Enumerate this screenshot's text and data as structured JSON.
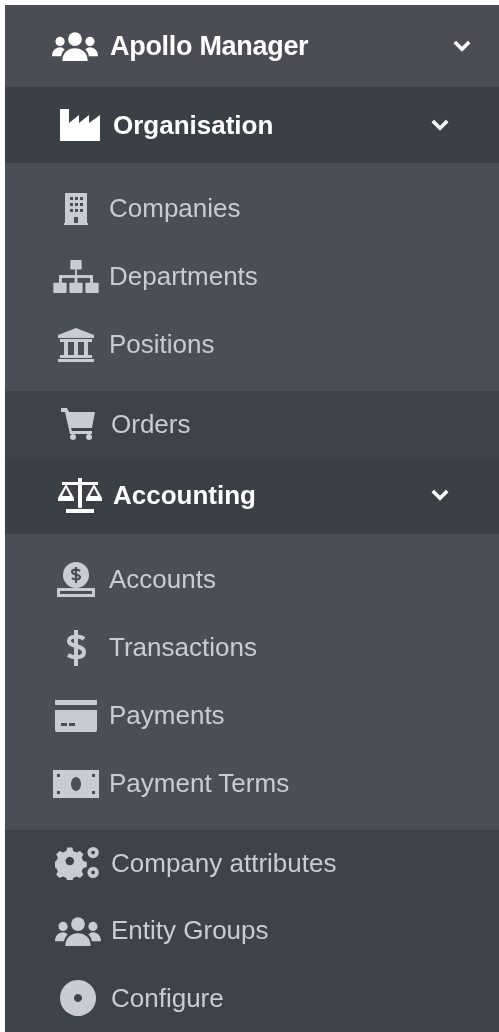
{
  "header": {
    "title": "Apollo Manager",
    "expanded": true
  },
  "menu": [
    {
      "kind": "group",
      "label": "Organisation",
      "expanded": true,
      "children": [
        {
          "label": "Companies"
        },
        {
          "label": "Departments"
        },
        {
          "label": "Positions"
        }
      ]
    },
    {
      "kind": "link",
      "label": "Orders"
    },
    {
      "kind": "group",
      "label": "Accounting",
      "expanded": true,
      "children": [
        {
          "label": "Accounts"
        },
        {
          "label": "Transactions"
        },
        {
          "label": "Payments"
        },
        {
          "label": "Payment Terms"
        }
      ]
    },
    {
      "kind": "link",
      "label": "Company attributes"
    },
    {
      "kind": "link",
      "label": "Entity Groups"
    },
    {
      "kind": "link",
      "label": "Configure"
    }
  ]
}
